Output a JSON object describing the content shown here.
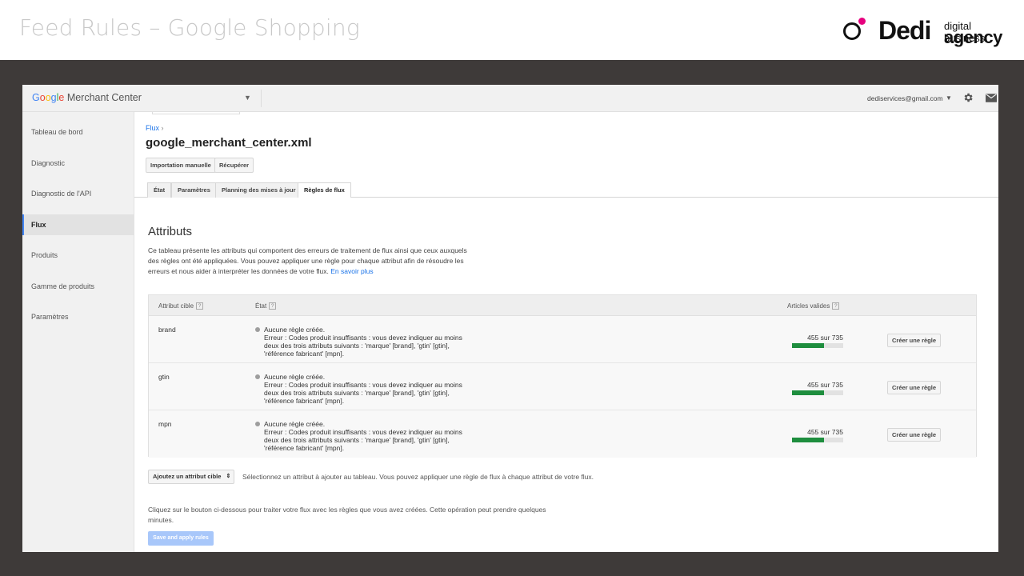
{
  "slide": {
    "title": "Feed Rules – Google Shopping",
    "logo_word": "Dedi",
    "logo_sub1": "digital business",
    "logo_sub2": "agency"
  },
  "topbar": {
    "brand_g": "Google",
    "brand_product": "Merchant Center",
    "account_email": "dediservices@gmail.com"
  },
  "sidebar": {
    "items": [
      {
        "label": "Tableau de bord"
      },
      {
        "label": "Diagnostic"
      },
      {
        "label": "Diagnostic de l'API"
      },
      {
        "label": "Flux"
      },
      {
        "label": "Produits"
      },
      {
        "label": "Gamme de produits"
      },
      {
        "label": "Paramètres"
      }
    ],
    "active_index": 3
  },
  "main": {
    "breadcrumb": "Flux",
    "breadcrumb_sep": "›",
    "title": "google_merchant_center.xml",
    "buttons": {
      "manual_import": "Importation manuelle",
      "fetch": "Récupérer"
    },
    "tabs": [
      {
        "label": "État"
      },
      {
        "label": "Paramètres"
      },
      {
        "label": "Planning des mises à jour"
      },
      {
        "label": "Règles de flux"
      }
    ],
    "active_tab": 3,
    "section_title": "Attributs",
    "description": "Ce tableau présente les attributs qui comportent des erreurs de traitement de flux ainsi que ceux auxquels des règles ont été appliquées. Vous pouvez appliquer une règle pour chaque attribut afin de résoudre les erreurs et nous aider à interpréter les données de votre flux.",
    "learn_more": "En savoir plus"
  },
  "table": {
    "headers": {
      "target": "Attribut cible",
      "state": "État",
      "valid": "Articles valides",
      "help": "?"
    },
    "rows": [
      {
        "attr": "brand",
        "state_title": "Aucune règle créée.",
        "error": "Erreur : Codes produit insuffisants : vous devez indiquer au moins deux des trois attributs suivants : 'marque' [brand], 'gtin' [gtin], 'référence fabricant' [mpn].",
        "count": "455 sur 735",
        "valid_fraction": 0.619,
        "button": "Créer une règle"
      },
      {
        "attr": "gtin",
        "state_title": "Aucune règle créée.",
        "error": "Erreur : Codes produit insuffisants : vous devez indiquer au moins deux des trois attributs suivants : 'marque' [brand], 'gtin' [gtin], 'référence fabricant' [mpn].",
        "count": "455 sur 735",
        "valid_fraction": 0.619,
        "button": "Créer une règle"
      },
      {
        "attr": "mpn",
        "state_title": "Aucune règle créée.",
        "error": "Erreur : Codes produit insuffisants : vous devez indiquer au moins deux des trois attributs suivants : 'marque' [brand], 'gtin' [gtin], 'référence fabricant' [mpn].",
        "count": "455 sur 735",
        "valid_fraction": 0.619,
        "button": "Créer une règle"
      }
    ]
  },
  "footer": {
    "add_select": "Ajoutez un attribut cible",
    "add_hint": "Sélectionnez un attribut à ajouter au tableau. Vous pouvez appliquer une règle de flux à chaque attribut de votre flux.",
    "apply_desc": "Cliquez sur le bouton ci-dessous pour traiter votre flux avec les règles que vous avez créées. Cette opération peut prendre quelques minutes.",
    "apply_button": "Save and apply rules"
  },
  "colors": {
    "accent": "#1a73e8",
    "progress": "#1e8e3e",
    "frame": "#3e3a39",
    "logo_dot": "#e6007e"
  }
}
